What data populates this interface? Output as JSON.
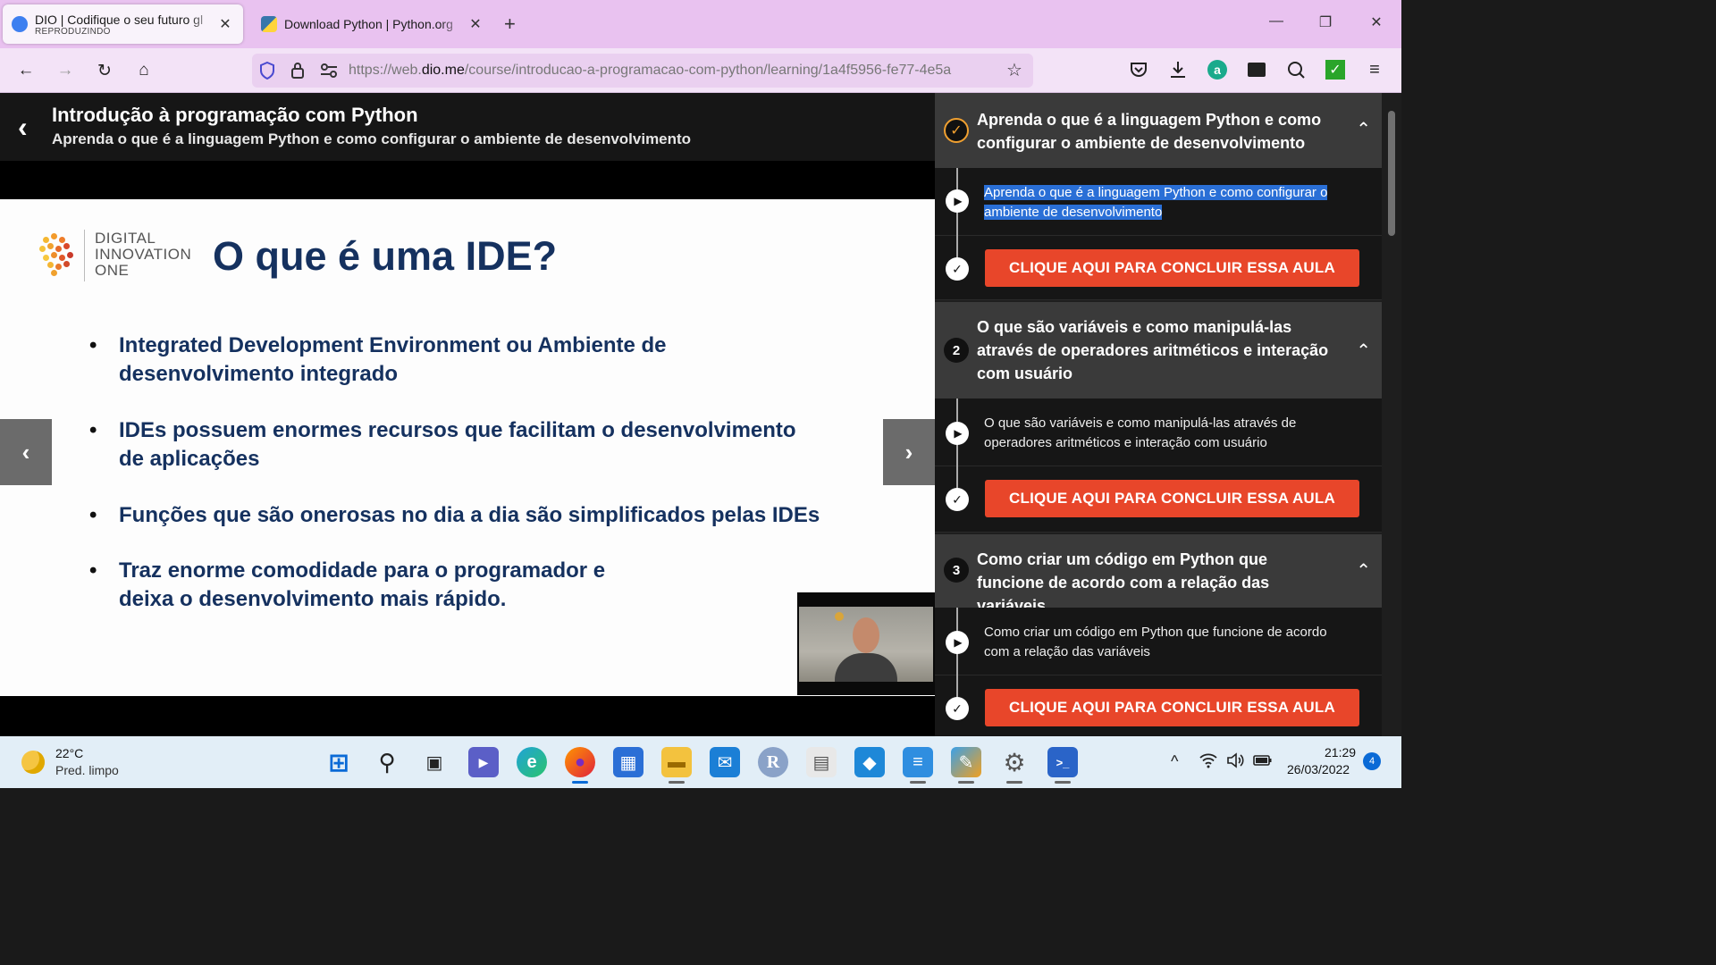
{
  "browser": {
    "tabs": [
      {
        "title": "DIO | Codifique o seu futuro gl",
        "subtitle": "REPRODUZINDO",
        "close": "✕"
      },
      {
        "title": "Download Python | Python.org",
        "close": "✕"
      }
    ],
    "new_tab": "+",
    "window_controls": {
      "minimize": "—",
      "restore": "❐",
      "close": "✕"
    },
    "nav": {
      "back": "←",
      "forward": "→",
      "reload": "↻",
      "home": "⌂"
    },
    "url": {
      "prefix": "https://web.",
      "host": "dio.me",
      "path": "/course/introducao-a-programacao-com-python/learning/1a4f5956-fe77-4e5a"
    }
  },
  "course": {
    "title": "Introdução à programação com Python",
    "subtitle": "Aprenda o que é a linguagem Python e como configurar o ambiente de desenvolvimento"
  },
  "slide": {
    "logo_lines": [
      "DIGITAL",
      "INNOVATION",
      "ONE"
    ],
    "title": "O que é uma IDE?",
    "bullets": [
      {
        "line1": "Integrated Development Environment ou Ambiente de",
        "line2": "desenvolvimento integrado"
      },
      {
        "line1": "IDEs possuem enormes recursos que facilitam o desenvolvimento",
        "line2": "de aplicações"
      },
      {
        "line1": "Funções que são onerosas no dia a dia são simplificados pelas IDEs",
        "line2": ""
      },
      {
        "line1": "Traz enorme comodidade para o programador e",
        "line2": "deixa o desenvolvimento mais rápido."
      }
    ],
    "bullet_char": "•",
    "prev_arrow": "‹",
    "next_arrow": "›"
  },
  "sidebar": {
    "modules": [
      {
        "number": "✓",
        "status": "done",
        "title": "Aprenda o que é a linguagem Python e como configurar o ambiente de desenvolvimento",
        "lesson": "Aprenda o que é a linguagem Python e como configurar o ambiente de desenvolvimento",
        "button": "CLIQUE AQUI PARA CONCLUIR ESSA AULA"
      },
      {
        "number": "2",
        "status": "pending",
        "title": "O que são variáveis e como manipulá-las através de operadores aritméticos e interação com usuário",
        "lesson": "O que são variáveis e como manipulá-las através de operadores aritméticos e interação com usuário",
        "button": "CLIQUE AQUI PARA CONCLUIR ESSA AULA"
      },
      {
        "number": "3",
        "status": "pending",
        "title": "Como criar um código em Python que funcione de acordo com a relação das variáveis",
        "lesson": "Como criar um código em Python que funcione de acordo com a relação das variáveis",
        "button": "CLIQUE AQUI PARA CONCLUIR ESSA AULA"
      }
    ],
    "caret": "⌃",
    "play": "▶",
    "check": "✓"
  },
  "taskbar": {
    "weather": {
      "temp": "22°C",
      "desc": "Pred. limpo"
    },
    "clock": {
      "time": "21:29",
      "date": "26/03/2022"
    },
    "notifications": "4",
    "apps": [
      {
        "name": "start",
        "glyph": "⊞"
      },
      {
        "name": "search",
        "glyph": "⚲"
      },
      {
        "name": "task-view",
        "glyph": "▣"
      },
      {
        "name": "teams",
        "glyph": "▶"
      },
      {
        "name": "edge",
        "glyph": "e"
      },
      {
        "name": "firefox",
        "glyph": "●"
      },
      {
        "name": "store",
        "glyph": "▦"
      },
      {
        "name": "explorer",
        "glyph": "▬"
      },
      {
        "name": "mail",
        "glyph": "✉"
      },
      {
        "name": "r-app",
        "glyph": "R"
      },
      {
        "name": "files",
        "glyph": "▤"
      },
      {
        "name": "vscode",
        "glyph": "◆"
      },
      {
        "name": "notepad",
        "glyph": "≡"
      },
      {
        "name": "paint",
        "glyph": "✎"
      },
      {
        "name": "settings",
        "glyph": "⚙"
      },
      {
        "name": "terminal",
        "glyph": ">_"
      }
    ],
    "tray": {
      "chevron": "^",
      "wifi": "📶",
      "volume": "🔊",
      "battery": "🔋"
    }
  },
  "colors": {
    "accent": "#e8462a",
    "slide_text": "#15315f",
    "tab_strip": "#e9c2f0",
    "done_badge": "#f0a030",
    "selection": "#2a6fd6"
  }
}
